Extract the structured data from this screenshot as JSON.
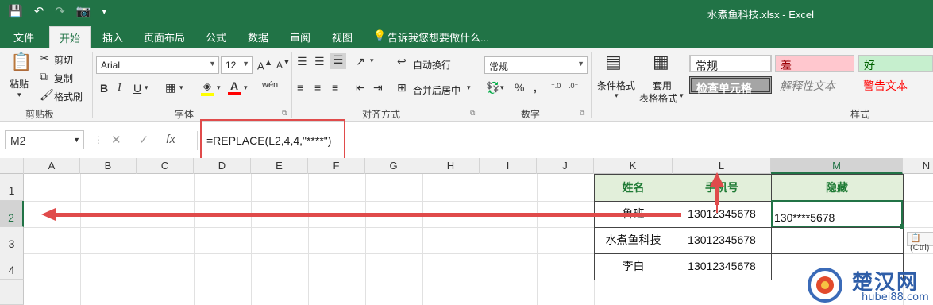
{
  "window": {
    "title": "水煮鱼科技.xlsx - Excel"
  },
  "qat": {
    "save": "💾",
    "undo": "↶",
    "redo": "↷",
    "camera": "📷",
    "more": "▾"
  },
  "tabs": [
    "文件",
    "开始",
    "插入",
    "页面布局",
    "公式",
    "数据",
    "审阅",
    "视图"
  ],
  "tell_me": "告诉我您想要做什么...",
  "ribbon": {
    "clipboard": {
      "paste": "粘贴",
      "cut": "剪切",
      "copy": "复制",
      "format_painter": "格式刷",
      "label": "剪贴板"
    },
    "font": {
      "name": "Arial",
      "size": "12",
      "bold": "B",
      "italic": "I",
      "underline": "U",
      "label": "字体"
    },
    "alignment": {
      "wrap": "自动换行",
      "merge": "合并后居中",
      "label": "对齐方式"
    },
    "number": {
      "format": "常规",
      "percent": "%",
      "comma": ",",
      "label": "数字"
    },
    "styles": {
      "cond_format": "条件格式",
      "table_format_1": "套用",
      "table_format_2": "表格格式",
      "normal": "常规",
      "bad": "差",
      "good": "好",
      "check_cell": "检查单元格",
      "explanatory": "解释性文本",
      "warning": "警告文本",
      "label": "样式"
    }
  },
  "formula_bar": {
    "name_box": "M2",
    "cancel": "✕",
    "enter": "✓",
    "fx": "fx",
    "formula": "=REPLACE(L2,4,4,\"****\")"
  },
  "columns": [
    "A",
    "B",
    "C",
    "D",
    "E",
    "F",
    "G",
    "H",
    "I",
    "J",
    "K",
    "L",
    "M",
    "N"
  ],
  "rows": [
    "1",
    "2",
    "3",
    "4"
  ],
  "table": {
    "headers": [
      "姓名",
      "手机号",
      "隐藏"
    ],
    "rows": [
      [
        "鲁班",
        "13012345678",
        "130****5678"
      ],
      [
        "水煮鱼科技",
        "13012345678",
        ""
      ],
      [
        "李白",
        "13012345678",
        ""
      ]
    ]
  },
  "paste_options": "(Ctrl)",
  "watermark": {
    "name": "楚汉网",
    "url": "hubei88.com"
  },
  "colors": {
    "excel_green": "#217346",
    "annotation_red": "#e04b4b",
    "header_fill": "#e2efda"
  }
}
